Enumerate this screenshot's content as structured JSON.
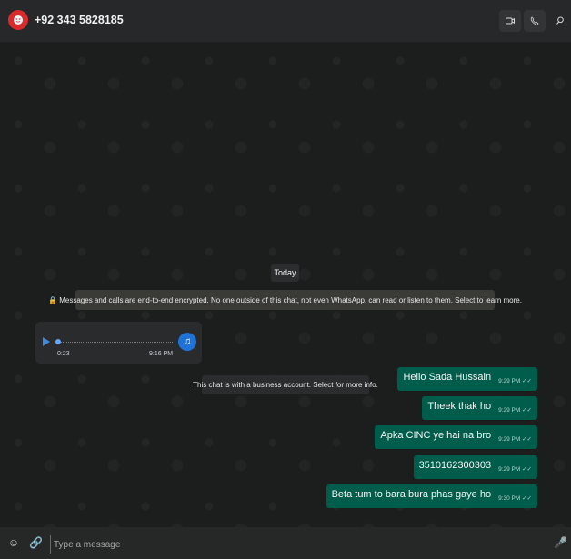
{
  "header": {
    "contact_name": "+92 343 5828185",
    "icons": {
      "video": "video-icon",
      "call": "phone-icon",
      "search": "search-icon"
    }
  },
  "chat": {
    "date_label": "Today",
    "encryption_notice": "🔒 Messages and calls are end-to-end encrypted. No one outside of this chat, not even WhatsApp, can read or listen to them. Select to learn more.",
    "business_notice": "This chat is with a business account. Select for more info.",
    "voice_message": {
      "duration": "0:23",
      "time": "9:16 PM"
    },
    "outgoing_messages": [
      {
        "text": "Hello Sada Hussain",
        "time": "9:29 PM ✓✓"
      },
      {
        "text": "Theek thak ho",
        "time": "9:29 PM ✓✓"
      },
      {
        "text": "Apka CINC ye hai na bro",
        "time": "9:29 PM ✓✓"
      },
      {
        "text": "3510162300303",
        "time": "9:29 PM ✓✓"
      },
      {
        "text": "Beta tum to bara bura phas gaye ho",
        "time": "9:30 PM ✓✓"
      }
    ]
  },
  "composer": {
    "placeholder": "Type a message"
  },
  "colors": {
    "outgoing_bubble": "#005c4b",
    "voice_accent": "#1f73d8",
    "avatar": "#d92b2b"
  }
}
